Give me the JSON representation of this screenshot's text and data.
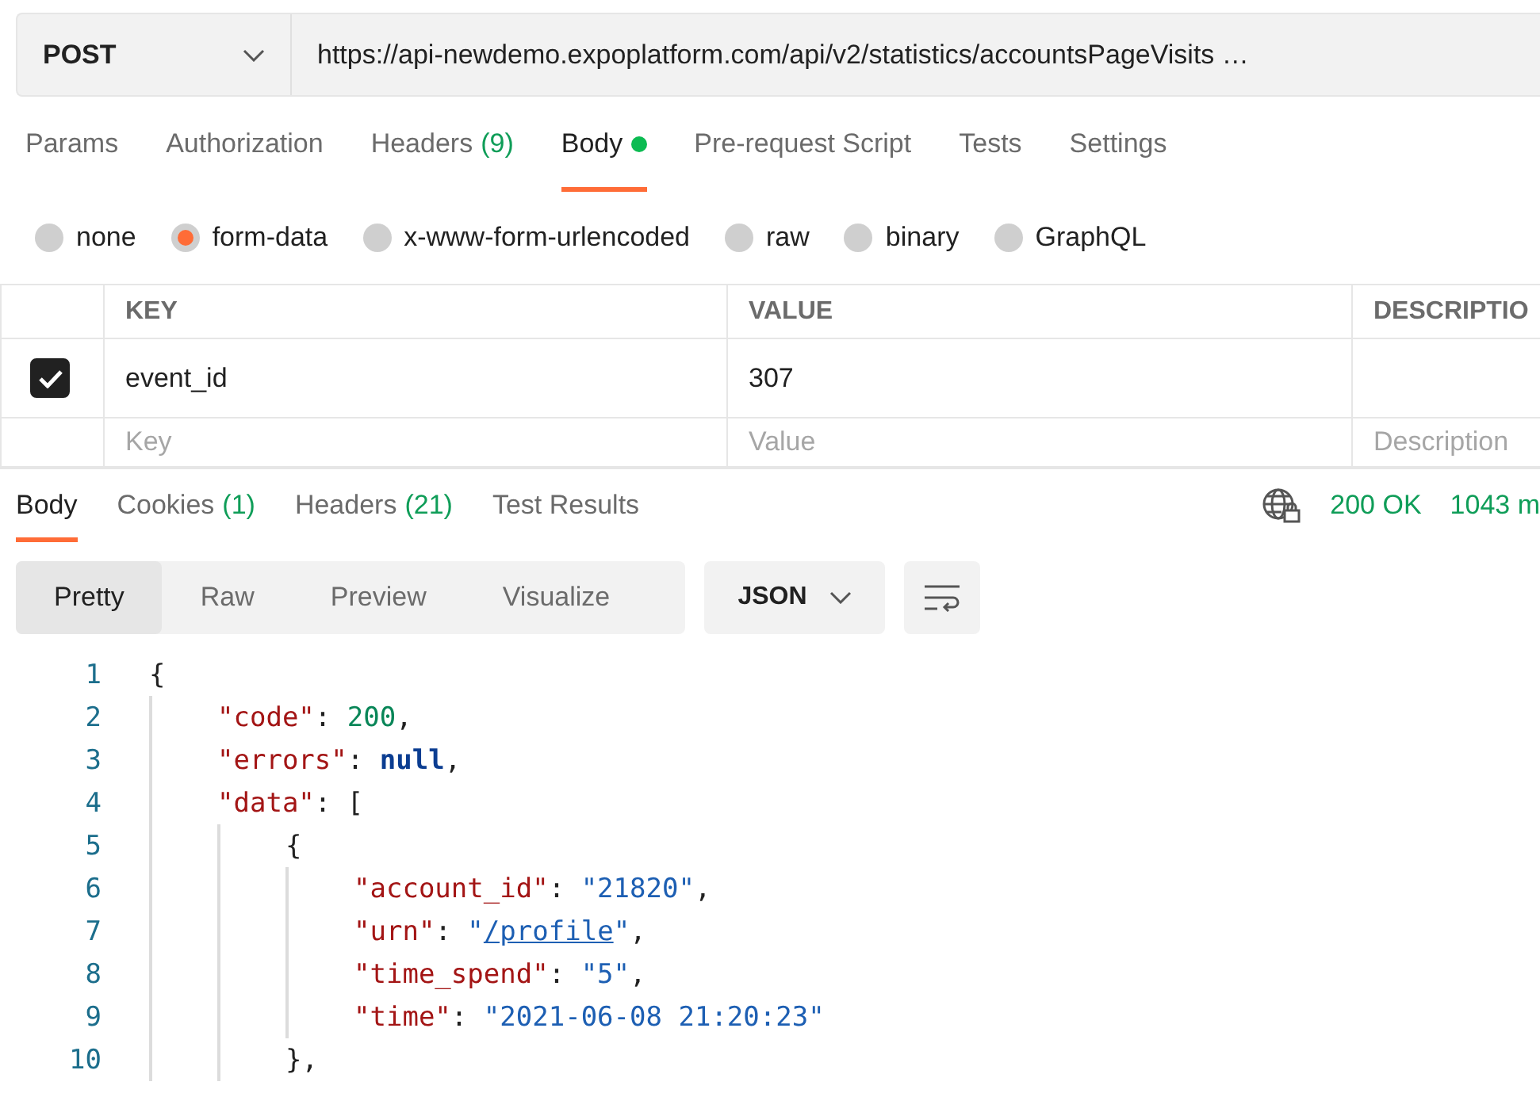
{
  "request": {
    "method": "POST",
    "url": "https://api-newdemo.expoplatform.com/api/v2/statistics/accountsPageVisits …"
  },
  "request_tabs": [
    {
      "label": "Params",
      "selected": false
    },
    {
      "label": "Authorization",
      "selected": false
    },
    {
      "label": "Headers",
      "count": "(9)",
      "selected": false
    },
    {
      "label": "Body",
      "dot": true,
      "selected": true
    },
    {
      "label": "Pre-request Script",
      "selected": false
    },
    {
      "label": "Tests",
      "selected": false
    },
    {
      "label": "Settings",
      "selected": false
    }
  ],
  "body_types": [
    {
      "label": "none",
      "selected": false
    },
    {
      "label": "form-data",
      "selected": true
    },
    {
      "label": "x-www-form-urlencoded",
      "selected": false
    },
    {
      "label": "raw",
      "selected": false
    },
    {
      "label": "binary",
      "selected": false
    },
    {
      "label": "GraphQL",
      "selected": false
    }
  ],
  "params_table": {
    "columns": [
      "KEY",
      "VALUE",
      "DESCRIPTIO"
    ],
    "rows": [
      {
        "checked": true,
        "key": "event_id",
        "value": "307"
      }
    ],
    "new_row": {
      "key_placeholder": "Key",
      "value_placeholder": "Value",
      "description_placeholder": "Description"
    }
  },
  "response_tabs": [
    {
      "label": "Body",
      "selected": true
    },
    {
      "label": "Cookies",
      "count": "(1)",
      "selected": false
    },
    {
      "label": "Headers",
      "count": "(21)",
      "selected": false
    },
    {
      "label": "Test Results",
      "selected": false
    }
  ],
  "response_status": {
    "status": "200 OK",
    "time": "1043 m"
  },
  "view_modes": [
    {
      "label": "Pretty",
      "selected": true
    },
    {
      "label": "Raw",
      "selected": false
    },
    {
      "label": "Preview",
      "selected": false
    },
    {
      "label": "Visualize",
      "selected": false
    }
  ],
  "format": "JSON",
  "code_lines": [
    {
      "number": "1",
      "tokens": [
        {
          "kind": "open",
          "text": "{"
        }
      ]
    },
    {
      "number": "2",
      "tokens": [
        {
          "kind": "key",
          "text": "\"code\""
        },
        {
          "kind": "punct",
          "text": ": "
        },
        {
          "kind": "number",
          "text": "200"
        },
        {
          "kind": "punct",
          "text": ","
        }
      ]
    },
    {
      "number": "3",
      "tokens": [
        {
          "kind": "key",
          "text": "\"errors\""
        },
        {
          "kind": "punct",
          "text": ": "
        },
        {
          "kind": "literal",
          "text": "null"
        },
        {
          "kind": "punct",
          "text": ","
        }
      ]
    },
    {
      "number": "4",
      "tokens": [
        {
          "kind": "key",
          "text": "\"data\""
        },
        {
          "kind": "punct",
          "text": ": "
        },
        {
          "kind": "open",
          "text": "["
        }
      ]
    },
    {
      "number": "5",
      "tokens": [
        {
          "kind": "open",
          "text": "{"
        }
      ]
    },
    {
      "number": "6",
      "tokens": [
        {
          "kind": "key",
          "text": "\"account_id\""
        },
        {
          "kind": "punct",
          "text": ": "
        },
        {
          "kind": "string",
          "text": "\"21820\""
        },
        {
          "kind": "punct",
          "text": ","
        }
      ]
    },
    {
      "number": "7",
      "tokens": [
        {
          "kind": "key",
          "text": "\"urn\""
        },
        {
          "kind": "punct",
          "text": ": "
        },
        {
          "kind": "string",
          "text": "\""
        },
        {
          "kind": "link",
          "text": "/profile"
        },
        {
          "kind": "string",
          "text": "\""
        },
        {
          "kind": "punct",
          "text": ","
        }
      ]
    },
    {
      "number": "8",
      "tokens": [
        {
          "kind": "key",
          "text": "\"time_spend\""
        },
        {
          "kind": "punct",
          "text": ": "
        },
        {
          "kind": "string",
          "text": "\"5\""
        },
        {
          "kind": "punct",
          "text": ","
        }
      ]
    },
    {
      "number": "9",
      "tokens": [
        {
          "kind": "key",
          "text": "\"time\""
        },
        {
          "kind": "punct",
          "text": ": "
        },
        {
          "kind": "string",
          "text": "\"2021-06-08 21:20:23\""
        }
      ]
    },
    {
      "number": "10",
      "tokens": [
        {
          "kind": "close",
          "text": "}"
        },
        {
          "kind": "punct",
          "text": ","
        }
      ]
    }
  ]
}
